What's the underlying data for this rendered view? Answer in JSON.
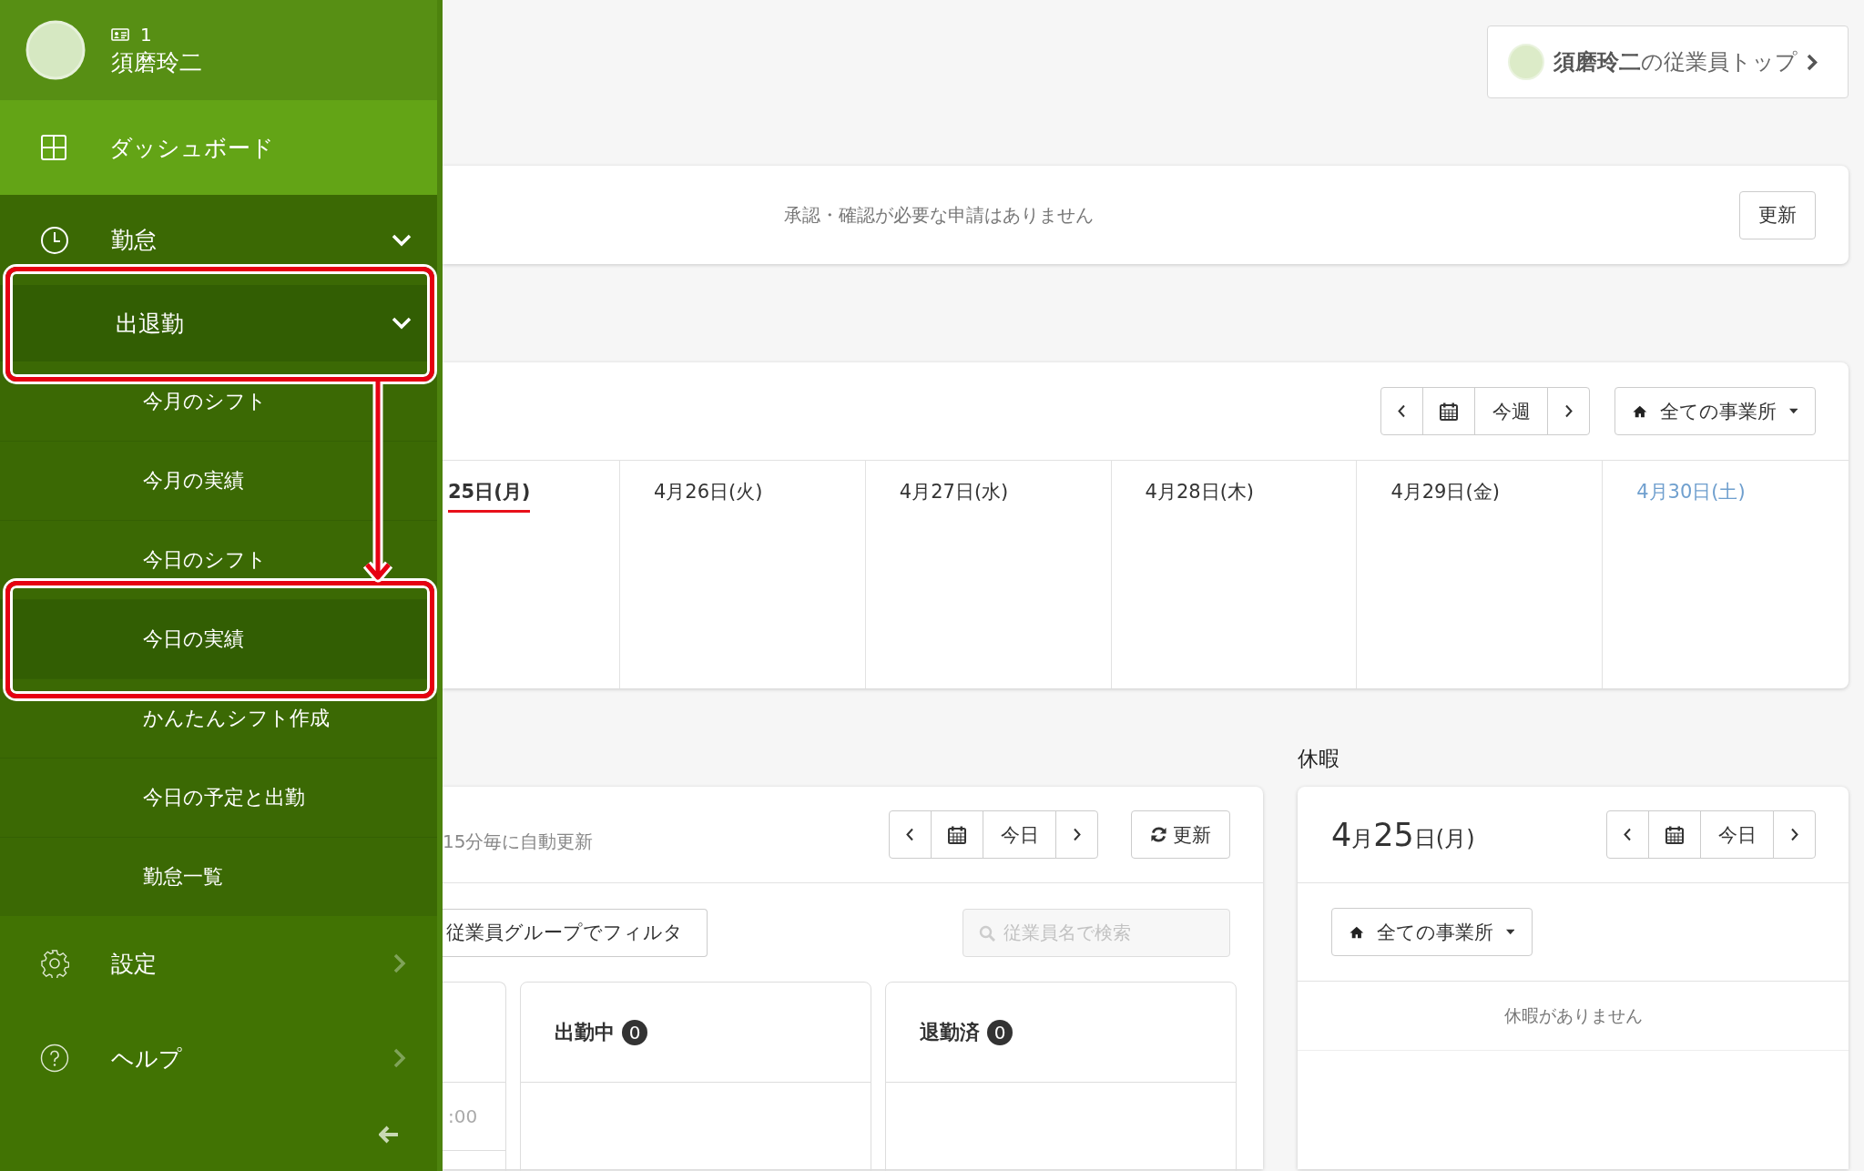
{
  "sidebar": {
    "user": {
      "employee_id": "1",
      "name": "須磨玲二"
    },
    "items": [
      {
        "label": "ダッシュボード",
        "selected": true
      },
      {
        "label": "勤怠",
        "selected": false,
        "expanded": true,
        "children": [
          {
            "label": "出退勤",
            "selected": false,
            "expanded": true,
            "highlighted": true,
            "children": [
              {
                "label": "今月のシフト",
                "selected": false,
                "highlighted": false
              },
              {
                "label": "今月の実績",
                "selected": false,
                "highlighted": false
              },
              {
                "label": "今日のシフト",
                "selected": false,
                "highlighted": false
              },
              {
                "label": "今日の実績",
                "selected": true,
                "highlighted": true
              },
              {
                "label": "かんたんシフト作成",
                "selected": false,
                "highlighted": false
              },
              {
                "label": "今日の予定と出勤",
                "selected": false,
                "highlighted": false
              },
              {
                "label": "勤怠一覧",
                "selected": false,
                "highlighted": false
              }
            ]
          }
        ]
      },
      {
        "label": "設定",
        "selected": false,
        "expanded": false
      },
      {
        "label": "ヘルプ",
        "selected": false,
        "expanded": false
      }
    ]
  },
  "employee_top_button": "**須磨玲二**の従業員トップ",
  "approvals": {
    "message": "承認・確認が必要な申請はありません",
    "refresh_button": "更新"
  },
  "week": {
    "nav": {
      "today_label": "今週"
    },
    "office_filter": "全ての事業所",
    "days": [
      {
        "label": "25日(月)",
        "kind": "today"
      },
      {
        "label": "4月26日(火)",
        "kind": "weekday"
      },
      {
        "label": "4月27日(水)",
        "kind": "weekday"
      },
      {
        "label": "4月28日(木)",
        "kind": "weekday"
      },
      {
        "label": "4月29日(金)",
        "kind": "weekday"
      },
      {
        "label": "4月30日(土)",
        "kind": "saturday"
      }
    ]
  },
  "attendance": {
    "note": "15分毎に自動更新",
    "nav": {
      "today_label": "今日"
    },
    "refresh_button": "更新",
    "group_filter": "従業員グループでフィルタ",
    "search": {
      "placeholder": "従業員名で検索"
    },
    "columns": [
      {
        "kind": "partial",
        "rows": [
          ":00"
        ]
      },
      {
        "kind": "status",
        "title": "出勤中",
        "count": "0"
      },
      {
        "kind": "status",
        "title": "退勤済",
        "count": "0"
      }
    ]
  },
  "leave": {
    "heading": "休暇",
    "date_parts": [
      {
        "text": "4",
        "kind": "number"
      },
      {
        "text": "月",
        "kind": "unit"
      },
      {
        "text": "25",
        "kind": "number"
      },
      {
        "text": "日",
        "kind": "unit"
      },
      {
        "text": "(月)",
        "kind": "unit"
      }
    ],
    "nav": {
      "today_label": "今日"
    },
    "office_filter": "全ての事業所",
    "empty_message": "休暇がありません"
  }
}
